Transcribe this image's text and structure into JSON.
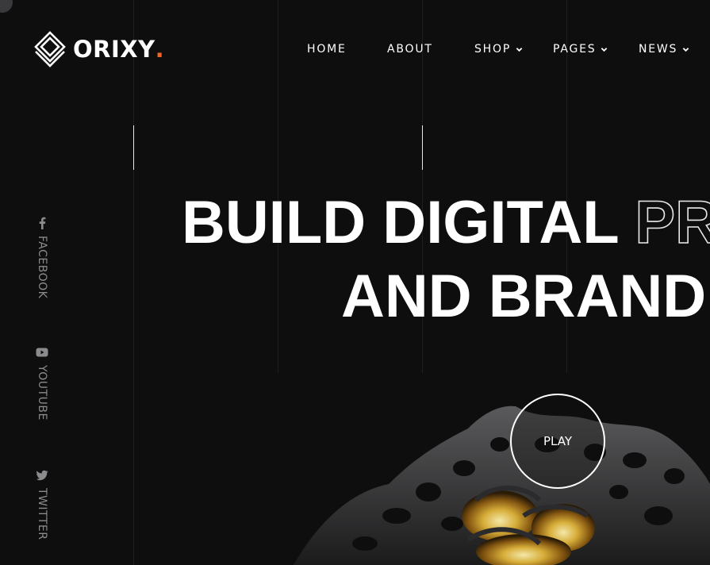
{
  "brand": {
    "name": "ORIXY",
    "dot": ".",
    "accent_color": "#f26522",
    "logo_icon": "layered-diamond-icon"
  },
  "nav": {
    "home": "HOME",
    "about": "ABOUT",
    "shop": "SHOP",
    "pages": "PAGES",
    "news": "NEWS"
  },
  "social": {
    "facebook": {
      "label": "FACEBOOK",
      "icon": "facebook-icon"
    },
    "youtube": {
      "label": "YOUTUBE",
      "icon": "youtube-icon"
    },
    "twitter": {
      "label": "TWITTER",
      "icon": "twitter-icon"
    }
  },
  "hero": {
    "line1_solid": "BUILD DIGITAL",
    "line1_outline": "PR",
    "line2": "AND BRAND"
  },
  "play_label": "PLAY"
}
